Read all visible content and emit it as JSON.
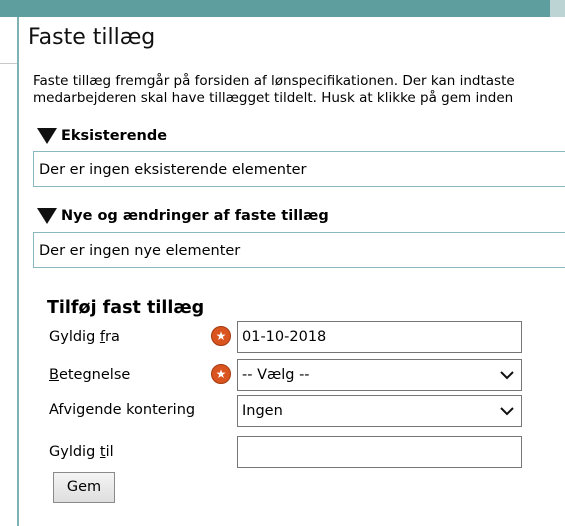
{
  "page": {
    "title": "Faste tillæg",
    "description_line1": "Faste tillæg fremgår på forsiden af lønspecifikationen. Der kan indtaste",
    "description_line2": "medarbejderen skal have tillægget tildelt. Husk at klikke på gem inden"
  },
  "existing": {
    "heading": "Eksisterende",
    "empty_text": "Der er ingen eksisterende elementer"
  },
  "new_changes": {
    "heading": "Nye og ændringer af faste tillæg",
    "empty_text": "Der er ingen nye elementer"
  },
  "form": {
    "title": "Tilføj fast tillæg",
    "valid_from": {
      "label_prefix": "Gyldig ",
      "label_underlined": "f",
      "label_suffix": "ra",
      "value": "01-10-2018",
      "required": true
    },
    "designation": {
      "label_underlined": "B",
      "label_suffix": "etegnelse",
      "value": "-- Vælg --",
      "required": true
    },
    "deviating_account": {
      "label": "Afvigende kontering",
      "value": "Ingen"
    },
    "valid_to": {
      "label_prefix": "Gyldig ",
      "label_underlined": "t",
      "label_suffix": "il",
      "value": ""
    },
    "save_label": "Gem"
  },
  "icons": {
    "required": "star-icon",
    "collapse": "triangle-down-icon",
    "dropdown": "chevron-down-icon"
  },
  "colors": {
    "topbar": "#5e9e9e",
    "required_badge": "#d9541e",
    "box_border": "#8ab8c0"
  }
}
